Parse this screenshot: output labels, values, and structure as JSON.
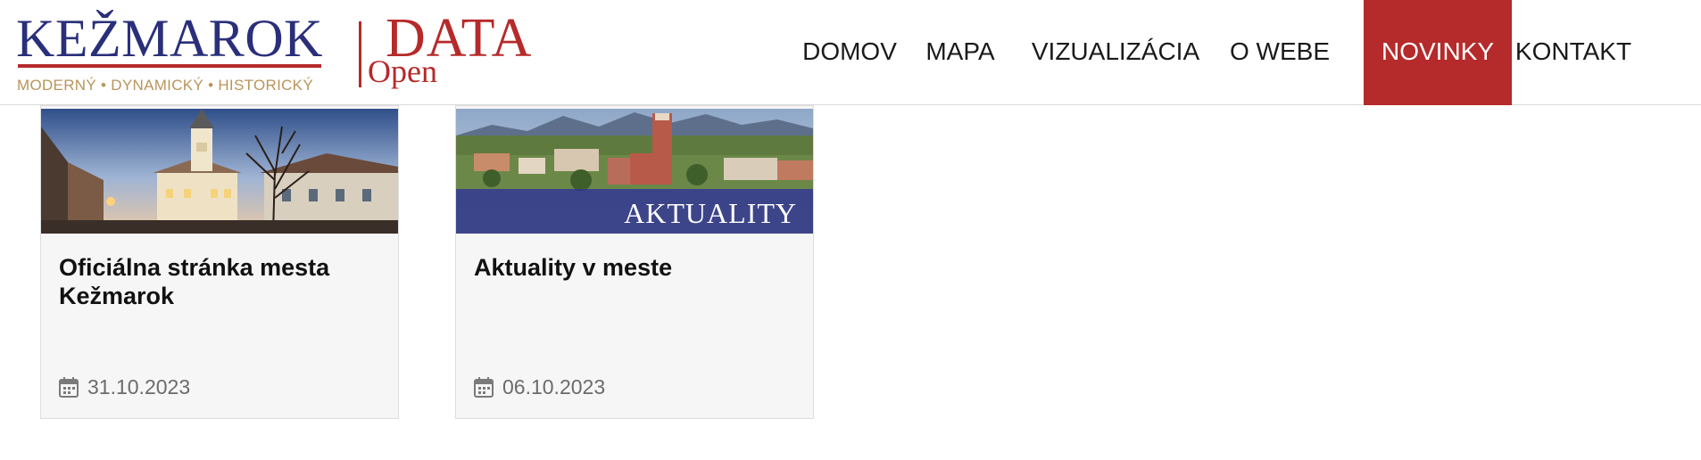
{
  "logo": {
    "city_name": "KEŽMAROK",
    "tagline": "MODERNÝ • DYNAMICKÝ • HISTORICKÝ",
    "data_word": "DATA",
    "open_word": "Open"
  },
  "nav": {
    "items": [
      {
        "label": "DOMOV",
        "active": false
      },
      {
        "label": "MAPA",
        "active": false
      },
      {
        "label": "VIZUALIZÁCIA",
        "active": false
      },
      {
        "label": "O WEBE",
        "active": false
      },
      {
        "label": "NOVINKY",
        "active": true
      },
      {
        "label": "KONTAKT",
        "active": false
      }
    ]
  },
  "cards": [
    {
      "title": "Oficiálna stránka mesta Kežmarok",
      "date": "31.10.2023",
      "image_icon": "town-square-photo"
    },
    {
      "title": "Aktuality v meste",
      "date": "06.10.2023",
      "image_icon": "city-panorama-photo",
      "image_caption": "AKTUALITY"
    }
  ],
  "colors": {
    "brand_red": "#b52a2a",
    "brand_navy": "#2a2f7a",
    "brand_gold": "#b8955a",
    "card_bg": "#f6f6f6",
    "date_text": "#6b6b6b"
  }
}
